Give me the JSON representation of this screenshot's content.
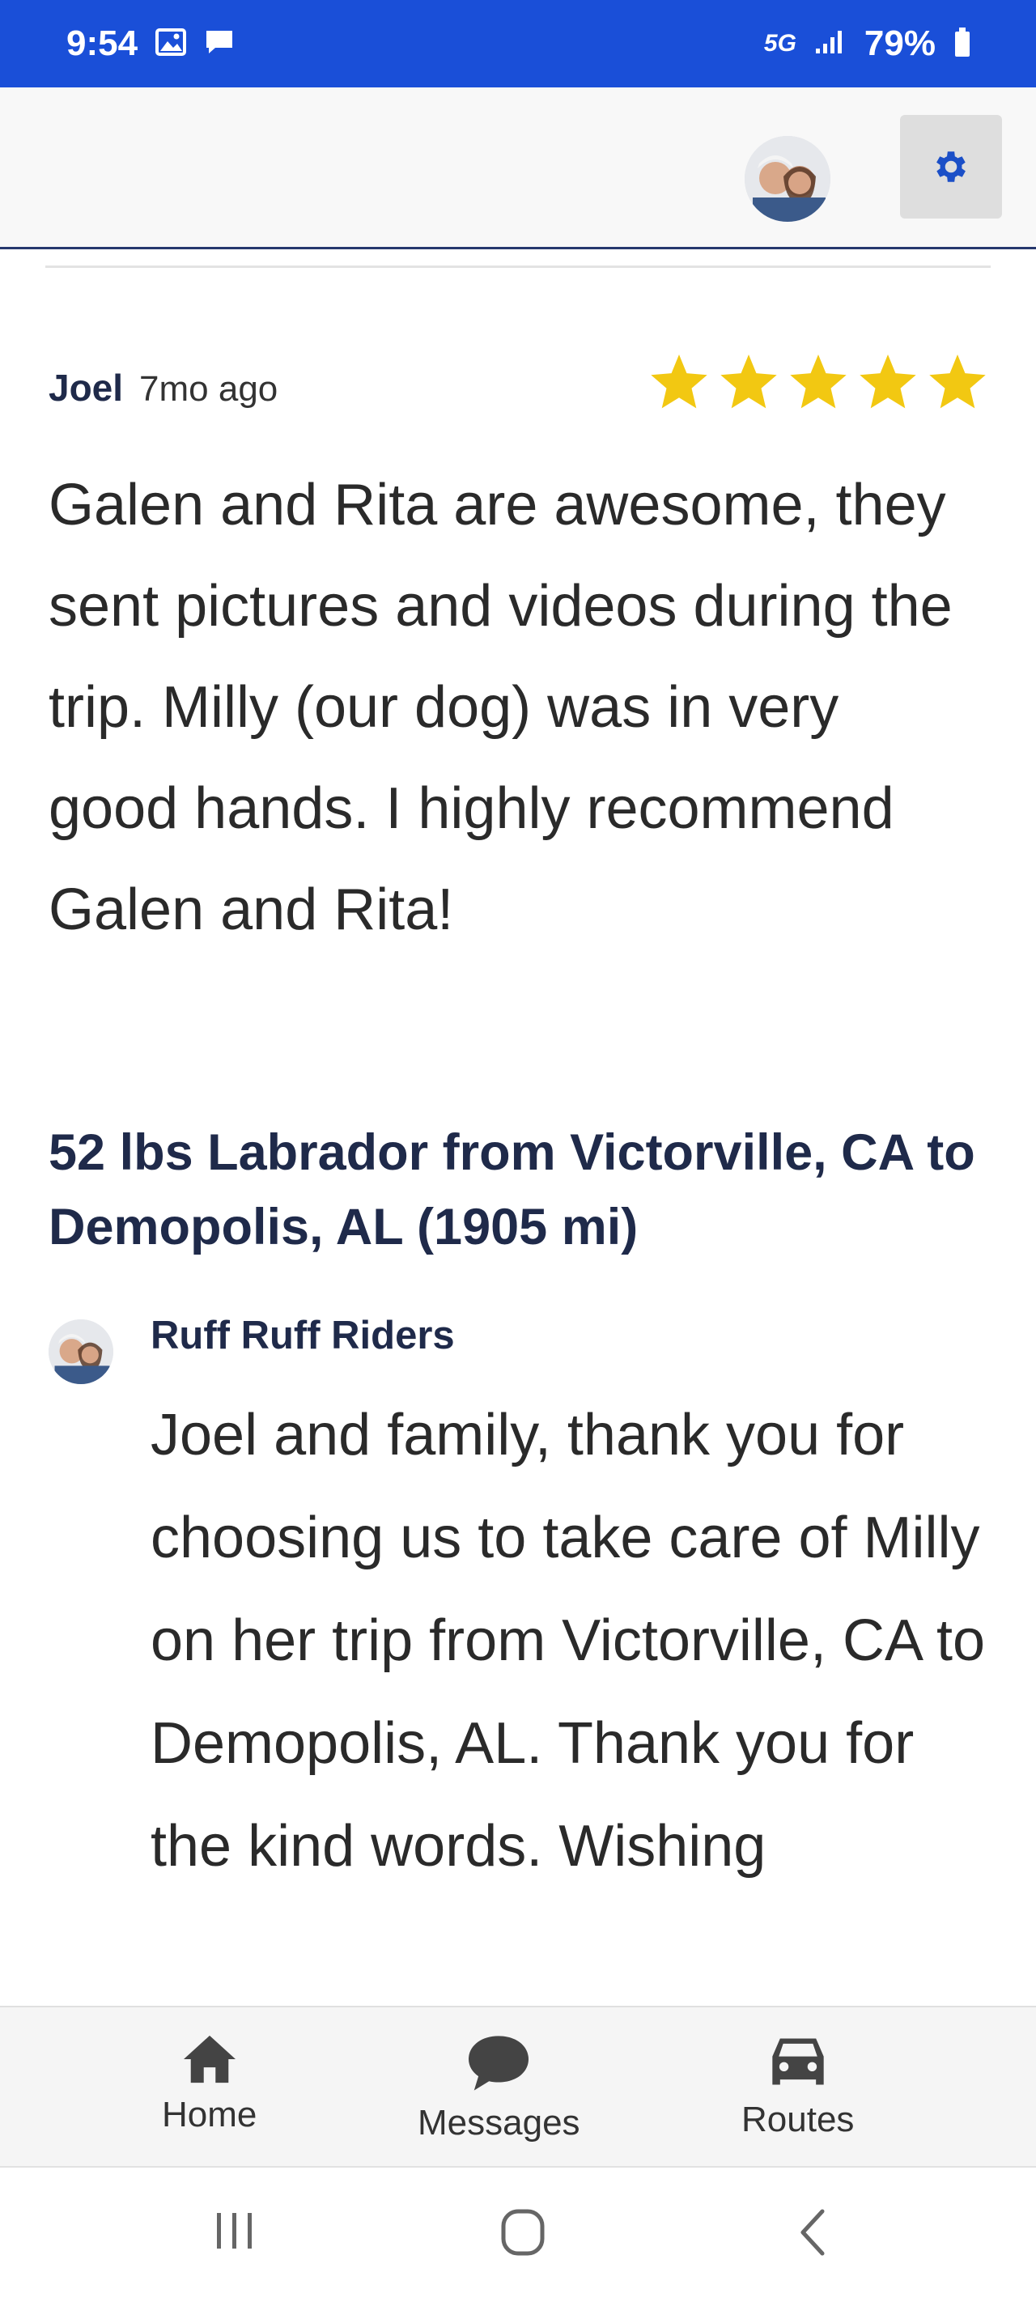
{
  "status_bar": {
    "time": "9:54",
    "network": "5G",
    "battery": "79%",
    "background_color": "#1a4fd8"
  },
  "header": {
    "settings_icon": "gear-icon",
    "accent_color": "#26386e"
  },
  "review": {
    "reviewer": "Joel",
    "time_ago": "7mo ago",
    "rating": 5,
    "rating_max": 5,
    "star_color": "#f2c812",
    "text": "Galen and Rita are awesome, they sent pictures and videos during the trip. Milly (our dog) was in very good hands. I highly recommend Galen and Rita!",
    "route_title": "52 lbs Labrador from Victorville, CA to Demopolis, AL (1905 mi)"
  },
  "reply": {
    "author": "Ruff Ruff Riders",
    "text": "Joel and family, thank you for choosing us to take care of Milly on her trip from Victorville, CA to Demopolis, AL. Thank you for the kind words. Wishing"
  },
  "bottom_nav": {
    "items": [
      {
        "label": "Home",
        "icon": "home-icon"
      },
      {
        "label": "Messages",
        "icon": "chat-bubble-icon"
      },
      {
        "label": "Routes",
        "icon": "car-icon"
      }
    ]
  },
  "system_nav": {
    "icons": [
      "recent-apps-icon",
      "home-circle-icon",
      "back-chevron-icon"
    ]
  }
}
